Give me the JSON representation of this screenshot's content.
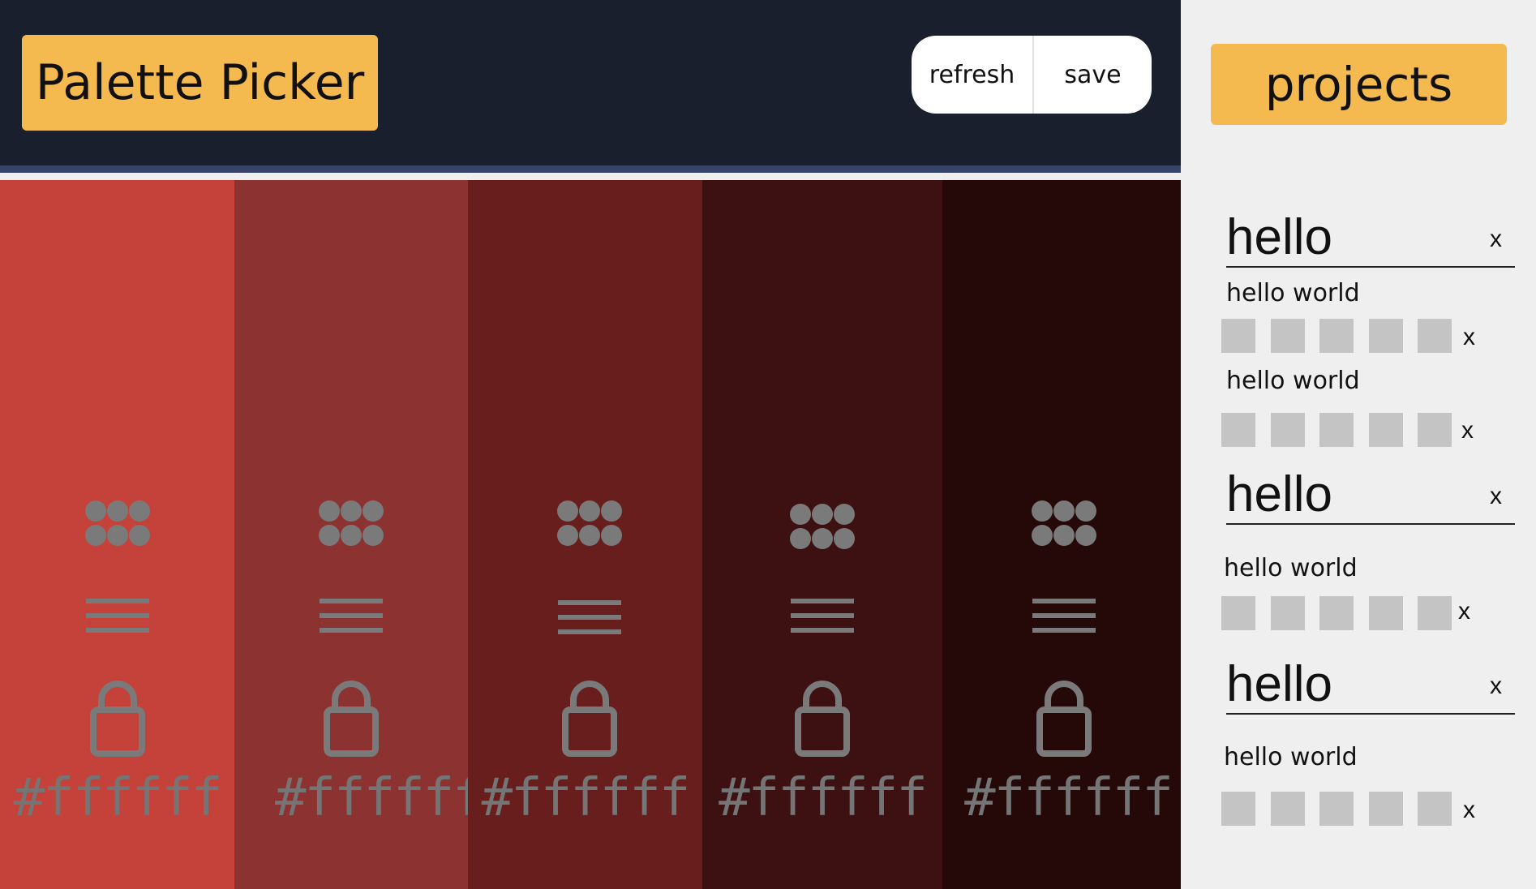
{
  "header": {
    "title": "Palette Picker",
    "refresh_label": "refresh",
    "save_label": "save"
  },
  "swatches": [
    {
      "color": "#c4423a",
      "hex_label": "#ffffff"
    },
    {
      "color": "#8c3332",
      "hex_label": "#ffffff"
    },
    {
      "color": "#681e1d",
      "hex_label": "#ffffff"
    },
    {
      "color": "#3d1112",
      "hex_label": "#ffffff"
    },
    {
      "color": "#250909",
      "hex_label": "#ffffff"
    }
  ],
  "sidebar": {
    "projects_label": "projects",
    "projects": [
      {
        "name": "hello",
        "delete_label": "x",
        "palettes": [
          {
            "name": "hello world",
            "delete_label": "x"
          },
          {
            "name": "hello world",
            "delete_label": "x"
          }
        ]
      },
      {
        "name": "hello",
        "delete_label": "x",
        "palettes": [
          {
            "name": "hello world",
            "delete_label": "x"
          }
        ]
      },
      {
        "name": "hello",
        "delete_label": "x",
        "palettes": [
          {
            "name": "hello world",
            "delete_label": "x"
          }
        ]
      }
    ]
  },
  "icons": {
    "swatch_drag": "dots-grip-icon",
    "swatch_menu": "hamburger-menu-icon",
    "swatch_lock": "lock-icon"
  },
  "colors": {
    "header_bg": "#1a1f2d",
    "header_border": "#344366",
    "accent": "#f4b94f",
    "sidebar_bg": "#efefef",
    "chip": "#c4c4c4",
    "icon_gray": "#7a7a7a"
  }
}
